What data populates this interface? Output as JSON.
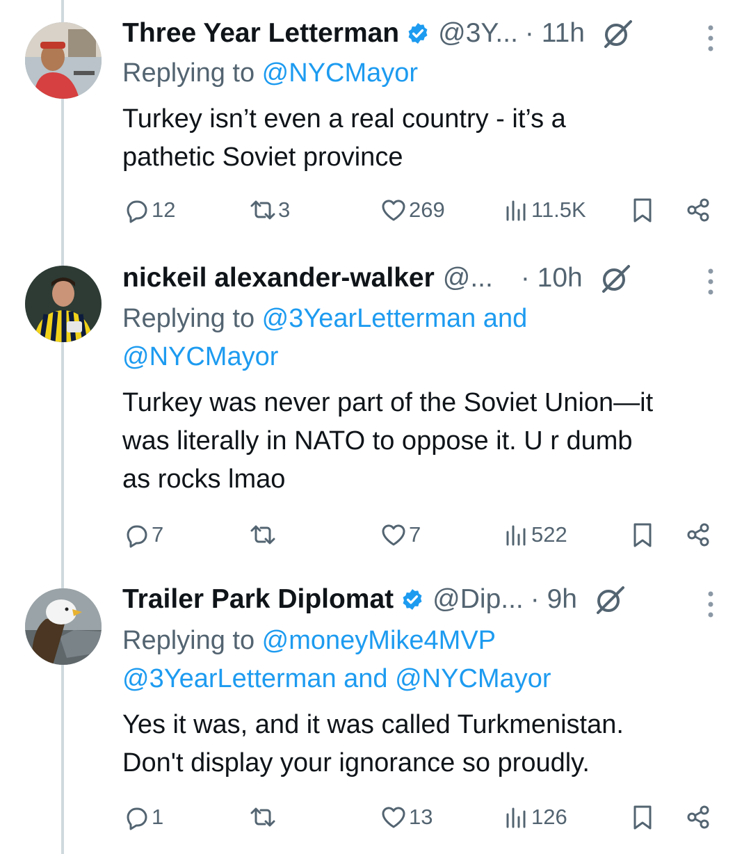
{
  "tweets": [
    {
      "name": "Three Year Letterman",
      "verified": true,
      "handle": "@3Y...",
      "time": "· 11h",
      "reply_prefix": "Replying to ",
      "reply_line1": "@NYCMayor",
      "reply_line2": "",
      "text": [
        "Turkey isn’t even a real country - it’s a",
        "pathetic Soviet province"
      ],
      "replies": "12",
      "reposts": "3",
      "likes": "269",
      "views": "11.5K",
      "avatar_bg": "#c9b6a4"
    },
    {
      "name": "nickeil alexander-walker",
      "verified": false,
      "handle": "@...",
      "time": "· 10h",
      "reply_prefix": "Replying to ",
      "reply_line1": "@3YearLetterman and",
      "reply_line2": "@NYCMayor",
      "text": [
        "Turkey was never part of the Soviet Union—it",
        "was literally in NATO to oppose it. U r dumb",
        "as rocks lmao"
      ],
      "replies": "7",
      "reposts": "",
      "likes": "7",
      "views": "522",
      "avatar_bg": "#33413a"
    },
    {
      "name": "Trailer Park Diplomat",
      "verified": true,
      "handle": "@Dip...",
      "time": "· 9h",
      "reply_prefix": "Replying to ",
      "reply_line1": "@moneyMike4MVP",
      "reply_line2": "@3YearLetterman and @NYCMayor",
      "text": [
        "Yes it was, and it was called Turkmenistan.",
        "Don't display your ignorance so proudly."
      ],
      "replies": "1",
      "reposts": "",
      "likes": "13",
      "views": "126",
      "avatar_bg": "#7f8a8f"
    }
  ],
  "colors": {
    "accent": "#1d9bf0",
    "muted": "#536471",
    "text": "#0f1419",
    "thread_line": "#cfd9de"
  },
  "icons": [
    "verified-badge-icon",
    "grok-icon",
    "more-icon",
    "reply-icon",
    "repost-icon",
    "like-icon",
    "views-icon",
    "bookmark-icon",
    "share-icon"
  ]
}
